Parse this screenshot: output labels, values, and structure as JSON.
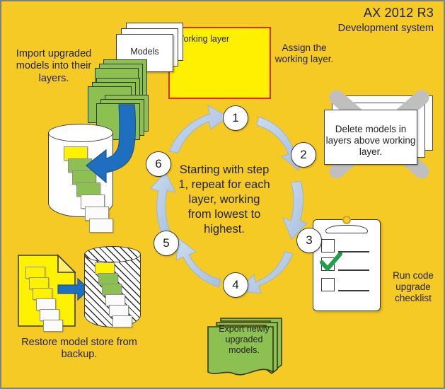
{
  "header": {
    "title": "AX 2012 R3",
    "subtitle": "Development system"
  },
  "working_layer": {
    "label": "Working layer",
    "card_label": "Models",
    "border_color": "#E8252A",
    "fill_color": "#FFEF00"
  },
  "callouts": {
    "assign": "Assign the working layer.",
    "import": "Import upgraded models into their layers.",
    "delete": "Delete models in layers above working layer.",
    "checklist": "Run code upgrade checklist",
    "export": "Export newly upgraded models.",
    "restore": "Restore model store from backup."
  },
  "cycle": {
    "center_text": "Starting with step 1, repeat for each layer, working from lowest to highest.",
    "steps": [
      {
        "number": "1"
      },
      {
        "number": "2"
      },
      {
        "number": "3"
      },
      {
        "number": "4"
      },
      {
        "number": "5"
      },
      {
        "number": "6"
      }
    ],
    "arrow_color": "#B9CDE5"
  },
  "colors": {
    "background": "#F6CA25",
    "green_model": "#8CC152",
    "blue_arrow": "#1F6FC0",
    "check_green": "#1FA14C",
    "delete_x_gray": "#BFBFBF"
  }
}
